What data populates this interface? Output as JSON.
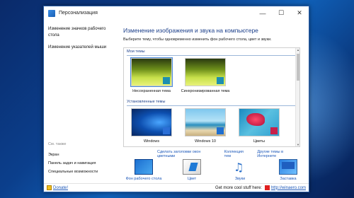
{
  "window": {
    "title": "Персонализация",
    "controls": {
      "minimize": "—",
      "maximize": "☐",
      "close": "✕"
    }
  },
  "sidebar": {
    "links": [
      "Изменение значков рабочего стола",
      "Изменение указателей мыши"
    ],
    "see_also": "См. также",
    "see_also_links": [
      "Экран",
      "Панель задач и навигация",
      "Специальные возможности"
    ],
    "params": "Параметры"
  },
  "main": {
    "heading": "Изменение изображения и звука на компьютере",
    "description": "Выберите тему, чтобы одновременно изменить фон рабочего стола, цвет и звуки.",
    "my_themes_label": "Мои темы",
    "my_themes": [
      "Несохраненная тема",
      "Синхронизированная тема"
    ],
    "installed_label": "Установленные темы",
    "installed": [
      "Windows",
      "Windows 10",
      "Цветы"
    ],
    "links": [
      "Сделать заголовки окон цветными",
      "Коллекция тем",
      "Другие темы в Интернете"
    ]
  },
  "bottom": {
    "items": [
      "Фон рабочего стола",
      "Цвет",
      "Звуки",
      "Заставка"
    ]
  },
  "footer": {
    "donate": "Donate!",
    "more": "Get more cool stuff here:",
    "winaero": "http://winaero.com"
  },
  "colors": {
    "accent": "#1a56b8",
    "heading": "#1a3e8a",
    "desktop": "#0b3f8c"
  },
  "icons": {
    "window": "personalization-icon",
    "note": "♫"
  }
}
